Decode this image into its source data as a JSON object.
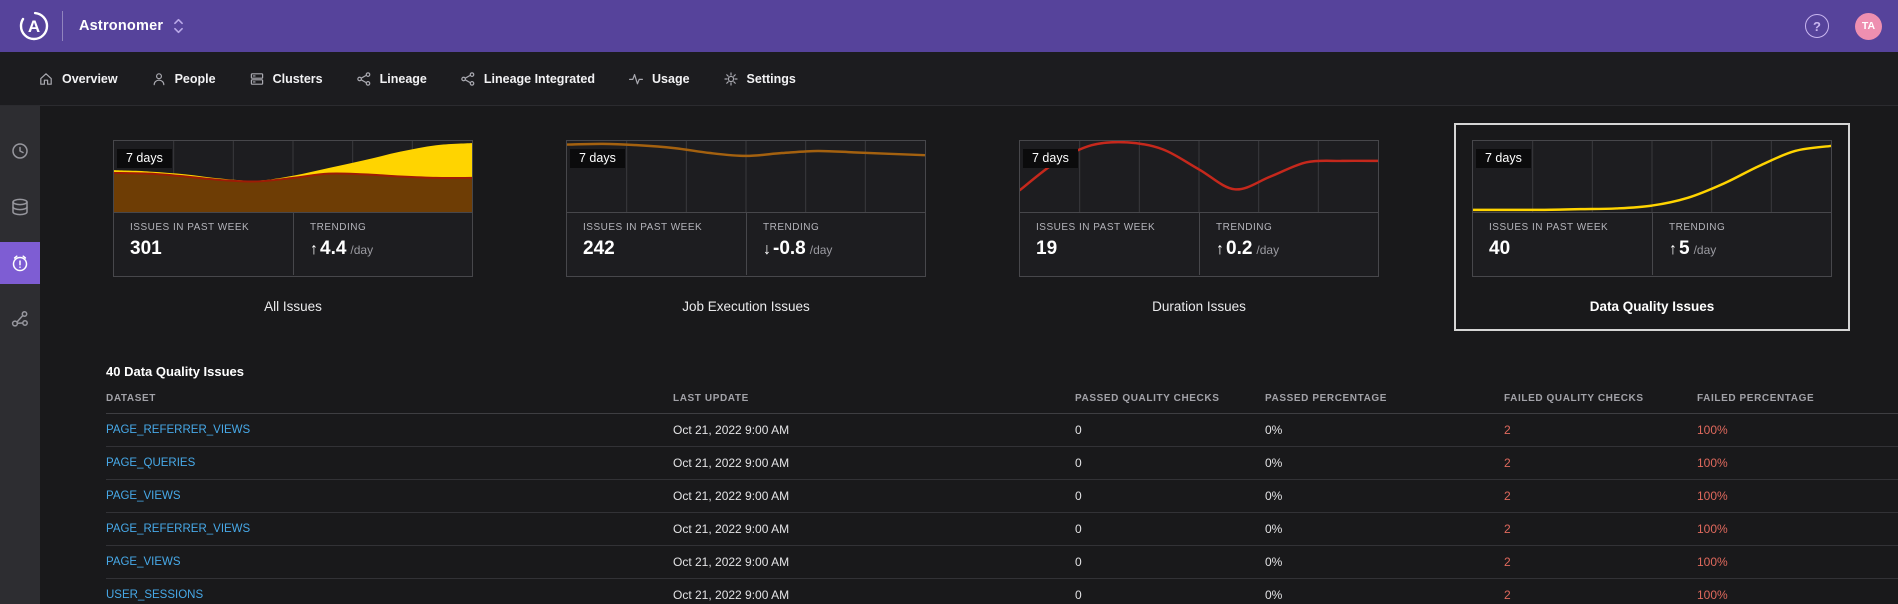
{
  "colors": {
    "topbar_purple": "#56439b",
    "sidebar_active_purple": "#7e5dd3",
    "link_blue": "#47a9e8",
    "alert_red": "#df695d",
    "avatar_pink": "#ee8fb0",
    "gridline": "#3a3a3e",
    "chart_yellow": "#ffd400",
    "chart_brown": "#6e3d05",
    "chart_dark_red": "#9e1b06",
    "chart_orange": "#a4610f",
    "chart_red": "#c5281c"
  },
  "topbar": {
    "brand": "Astronomer",
    "help_glyph": "?",
    "avatar_initials": "TA"
  },
  "nav": {
    "items": [
      {
        "label": "Overview",
        "icon": "home"
      },
      {
        "label": "People",
        "icon": "person"
      },
      {
        "label": "Clusters",
        "icon": "clusters"
      },
      {
        "label": "Lineage",
        "icon": "lineage"
      },
      {
        "label": "Lineage Integrated",
        "icon": "lineage"
      },
      {
        "label": "Usage",
        "icon": "pulse"
      },
      {
        "label": "Settings",
        "icon": "gear"
      }
    ]
  },
  "sidebar": {
    "items": [
      {
        "icon": "clock",
        "active": false
      },
      {
        "icon": "database",
        "active": false
      },
      {
        "icon": "alarm",
        "active": true
      },
      {
        "icon": "lineage",
        "active": false
      }
    ]
  },
  "cards": [
    {
      "title": "All Issues",
      "range_label": "7 days",
      "issues_label": "ISSUES IN PAST WEEK",
      "issues_value": "301",
      "trending_label": "TRENDING",
      "trend_arrow": "↑",
      "trend_value": "4.4",
      "trend_unit": "/day",
      "selected": false,
      "chart": {
        "type": "area",
        "x_range_days": 7,
        "series": [
          {
            "name": "data-quality-band",
            "kind": "area",
            "fill": "#ffd400",
            "stroke": null,
            "points": [
              0.41,
              0.43,
              0.47,
              0.53,
              0.56,
              0.49,
              0.38,
              0.27,
              0.15,
              0.06,
              0.03
            ]
          },
          {
            "name": "base-band",
            "kind": "area",
            "fill": "#6e3d05",
            "stroke": "#9e1b06",
            "points": [
              0.45,
              0.46,
              0.5,
              0.55,
              0.57,
              0.52,
              0.46,
              0.47,
              0.5,
              0.52,
              0.52
            ]
          }
        ]
      }
    },
    {
      "title": "Job Execution Issues",
      "range_label": "7 days",
      "issues_label": "ISSUES IN PAST WEEK",
      "issues_value": "242",
      "trending_label": "TRENDING",
      "trend_arrow": "↓",
      "trend_value": "-0.8",
      "trend_unit": "/day",
      "selected": false,
      "chart": {
        "type": "line",
        "x_range_days": 7,
        "series": [
          {
            "name": "job-execution-issues",
            "kind": "line",
            "stroke": "#a4610f",
            "fill": null,
            "points": [
              0.05,
              0.04,
              0.06,
              0.1,
              0.17,
              0.21,
              0.17,
              0.14,
              0.16,
              0.18,
              0.2
            ]
          }
        ]
      }
    },
    {
      "title": "Duration Issues",
      "range_label": "7 days",
      "issues_label": "ISSUES IN PAST WEEK",
      "issues_value": "19",
      "trending_label": "TRENDING",
      "trend_arrow": "↑",
      "trend_value": "0.2",
      "trend_unit": "/day",
      "selected": false,
      "chart": {
        "type": "line",
        "x_range_days": 7,
        "series": [
          {
            "name": "duration-issues",
            "kind": "line",
            "stroke": "#c5281c",
            "fill": null,
            "points": [
              0.69,
              0.3,
              0.06,
              0.02,
              0.12,
              0.4,
              0.68,
              0.5,
              0.3,
              0.28,
              0.28
            ]
          }
        ]
      }
    },
    {
      "title": "Data Quality Issues",
      "range_label": "7 days",
      "issues_label": "ISSUES IN PAST WEEK",
      "issues_value": "40",
      "trending_label": "TRENDING",
      "trend_arrow": "↑",
      "trend_value": "5",
      "trend_unit": "/day",
      "selected": true,
      "chart": {
        "type": "line",
        "x_range_days": 7,
        "series": [
          {
            "name": "data-quality-issues",
            "kind": "line",
            "stroke": "#ffd400",
            "fill": null,
            "points": [
              0.97,
              0.97,
              0.97,
              0.96,
              0.95,
              0.91,
              0.8,
              0.6,
              0.35,
              0.14,
              0.07
            ]
          }
        ]
      }
    }
  ],
  "table": {
    "title": "40 Data Quality Issues",
    "columns": [
      "DATASET",
      "LAST UPDATE",
      "PASSED QUALITY CHECKS",
      "PASSED PERCENTAGE",
      "FAILED QUALITY CHECKS",
      "FAILED PERCENTAGE"
    ],
    "rows": [
      {
        "dataset": "PAGE_REFERRER_VIEWS",
        "last_update": "Oct 21, 2022 9:00 AM",
        "passed_checks": "0",
        "passed_percentage": "0%",
        "failed_checks": "2",
        "failed_percentage": "100%"
      },
      {
        "dataset": "PAGE_QUERIES",
        "last_update": "Oct 21, 2022 9:00 AM",
        "passed_checks": "0",
        "passed_percentage": "0%",
        "failed_checks": "2",
        "failed_percentage": "100%"
      },
      {
        "dataset": "PAGE_VIEWS",
        "last_update": "Oct 21, 2022 9:00 AM",
        "passed_checks": "0",
        "passed_percentage": "0%",
        "failed_checks": "2",
        "failed_percentage": "100%"
      },
      {
        "dataset": "PAGE_REFERRER_VIEWS",
        "last_update": "Oct 21, 2022 9:00 AM",
        "passed_checks": "0",
        "passed_percentage": "0%",
        "failed_checks": "2",
        "failed_percentage": "100%"
      },
      {
        "dataset": "PAGE_VIEWS",
        "last_update": "Oct 21, 2022 9:00 AM",
        "passed_checks": "0",
        "passed_percentage": "0%",
        "failed_checks": "2",
        "failed_percentage": "100%"
      },
      {
        "dataset": "USER_SESSIONS",
        "last_update": "Oct 21, 2022 9:00 AM",
        "passed_checks": "0",
        "passed_percentage": "0%",
        "failed_checks": "2",
        "failed_percentage": "100%"
      }
    ]
  }
}
